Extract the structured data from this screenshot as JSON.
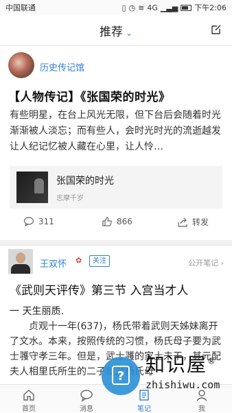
{
  "status": {
    "carrier": "中国联通",
    "time": "下午2:06",
    "signal_text": "4G"
  },
  "header": {
    "title": "推荐",
    "icons": {
      "dropdown": "chevron-down-icon",
      "compose": "edit-icon"
    }
  },
  "post1": {
    "author": "历史传记馆",
    "title": "【人物传记】《张国荣的时光》",
    "excerpt": "有些明星，在台上风光无限，但下台后会随着时光渐渐被人淡忘；而有些人，会时光时光的流逝越发让人纪记忆被人藏在心里，让人怜…",
    "link": {
      "title": "张国荣的时光",
      "subtitle": "志摩千岁"
    },
    "comments": "311",
    "likes": "866",
    "share": "转发"
  },
  "post2": {
    "author": "王双怀",
    "follow": "关注",
    "visibility": "公开笔记",
    "visibility_arrow": "›",
    "title": "《武则天评传》第三节  入宫当才人",
    "section_head": "一    天生丽质.",
    "paragraph": "贞观十一年(637)，杨氏带着武则天姊妹离开了文水。本来，按照传统的习惯，杨氏母子要为武士彟守孝三年。但是，武士彟的家土未干，其元配夫人相里氏所生的二子就对杨氏母"
  },
  "tabs": [
    {
      "label": "首页",
      "icon": "home-icon"
    },
    {
      "label": "消息",
      "icon": "message-icon"
    },
    {
      "label": "笔记",
      "icon": "notes-icon"
    },
    {
      "label": "我",
      "icon": "profile-icon"
    }
  ],
  "watermark": {
    "text": "知识屋",
    "reg": "®",
    "url": "zhishiwu.com",
    "q": "?"
  },
  "colors": {
    "accent": "#2f80d1",
    "divider": "#f0f0f0",
    "watermark_blue": "#2a8fd6"
  }
}
